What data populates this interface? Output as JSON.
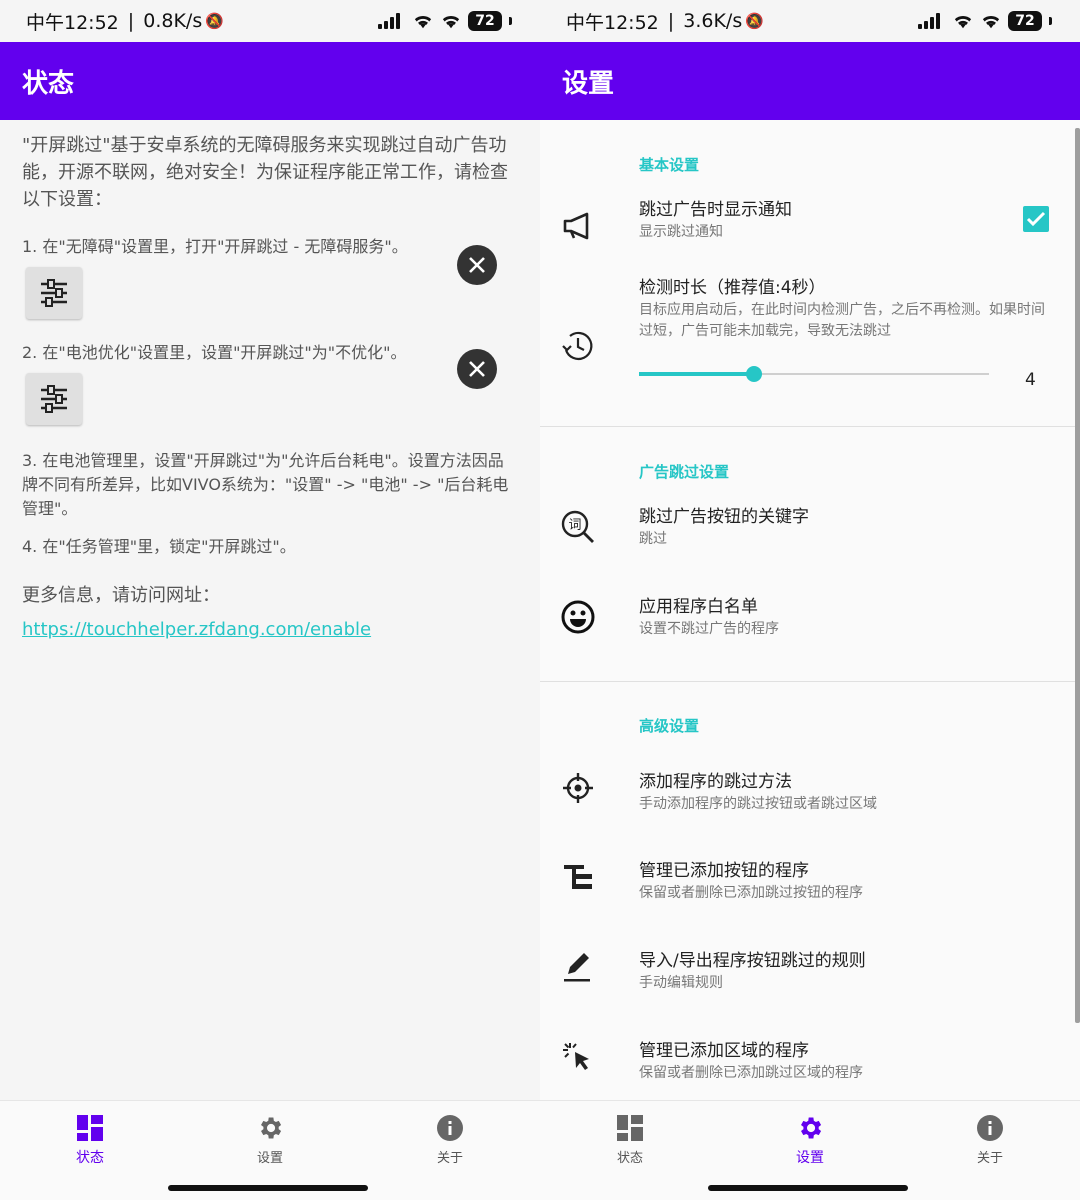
{
  "statusbar_left": {
    "time": "中午12:52",
    "speed": "0.8K/s",
    "battery": "72"
  },
  "statusbar_right": {
    "time": "中午12:52",
    "speed": "3.6K/s",
    "battery": "72"
  },
  "accent_colors": {
    "primary": "#6200ee",
    "teal": "#26c6c6"
  },
  "status_page": {
    "title": "状态",
    "intro": "\"开屏跳过\"基于安卓系统的无障碍服务来实现跳过自动广告功能，开源不联网，绝对安全！为保证程序能正常工作，请检查以下设置：",
    "step1": "1. 在\"无障碍\"设置里，打开\"开屏跳过 - 无障碍服务\"。",
    "step2": "2. 在\"电池优化\"设置里，设置\"开屏跳过\"为\"不优化\"。",
    "step3": "3. 在电池管理里，设置\"开屏跳过\"为\"允许后台耗电\"。设置方法因品牌不同有所差异，比如VIVO系统为：\"设置\" -> \"电池\" -> \"后台耗电管理\"。",
    "step4": "4. 在\"任务管理\"里，锁定\"开屏跳过\"。",
    "more_info": "更多信息，请访问网址：",
    "link": "https://touchhelper.zfdang.com/enable"
  },
  "settings_page": {
    "title": "设置",
    "cat_basic": "基本设置",
    "notify_title": "跳过广告时显示通知",
    "notify_summary": "显示跳过通知",
    "notify_checked": true,
    "detect_title": "检测时长（推荐值:4秒）",
    "detect_summary": "目标应用启动后，在此时间内检测广告，之后不再检测。如果时间过短，广告可能未加载完，导致无法跳过",
    "detect_value": "4",
    "cat_ad": "广告跳过设置",
    "keyword_title": "跳过广告按钮的关键字",
    "keyword_summary": "跳过",
    "whitelist_title": "应用程序白名单",
    "whitelist_summary": "设置不跳过广告的程序",
    "cat_advanced": "高级设置",
    "add_method_title": "添加程序的跳过方法",
    "add_method_summary": "手动添加程序的跳过按钮或者跳过区域",
    "manage_buttons_title": "管理已添加按钮的程序",
    "manage_buttons_summary": "保留或者删除已添加跳过按钮的程序",
    "import_title": "导入/导出程序按钮跳过的规则",
    "import_summary": "手动编辑规则",
    "manage_areas_title": "管理已添加区域的程序",
    "manage_areas_summary": "保留或者删除已添加跳过区域的程序"
  },
  "nav": {
    "status": "状态",
    "settings": "设置",
    "about": "关于"
  }
}
